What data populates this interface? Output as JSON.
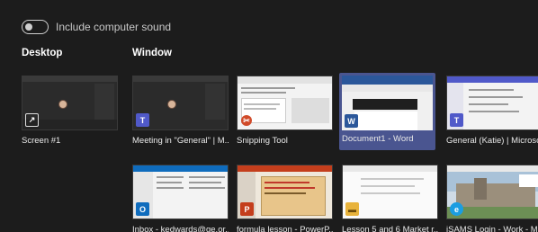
{
  "toggle": {
    "label": "Include computer sound",
    "on": false
  },
  "sections": {
    "desktop": "Desktop",
    "window": "Window"
  },
  "tiles": [
    {
      "label": "Screen #1",
      "icon": "share-screen-icon"
    },
    {
      "label": "Meeting in \"General\" | M...",
      "icon": "teams-icon"
    },
    {
      "label": "Snipping Tool",
      "icon": "snipping-tool-icon"
    },
    {
      "label": "Document1 - Word",
      "icon": "word-icon",
      "selected": true
    },
    {
      "label": "General (Katie) | Microso...",
      "icon": "teams-icon"
    },
    {
      "label": "Inbox - kedwards@ge.or...",
      "icon": "outlook-icon"
    },
    {
      "label": "formula lesson - PowerP...",
      "icon": "powerpoint-icon"
    },
    {
      "label": "Lesson 5 and 6 Market r...",
      "icon": "file-explorer-icon"
    },
    {
      "label": "iSAMS Login - Work - M...",
      "icon": "edge-icon"
    }
  ],
  "colors": {
    "background": "#1c1c1c",
    "selection": "#4a5590",
    "teams": "#5059c9",
    "word": "#2b579a",
    "outlook": "#0f6cbd",
    "powerpoint": "#c43e1c",
    "edge": "#1b9de2"
  }
}
